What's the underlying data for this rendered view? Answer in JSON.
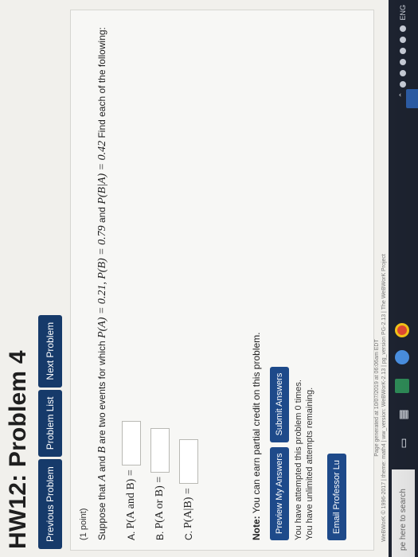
{
  "header": {
    "title": "HW12: Problem 4"
  },
  "nav": {
    "previous": "Previous Problem",
    "list": "Problem List",
    "next": "Next Problem"
  },
  "problem": {
    "points": "(1 point)",
    "intro": "Suppose that",
    "event_a": "A",
    "and": "and",
    "event_b": "B",
    "are_events": "are two events for which",
    "p_a": "P(A) = 0.21,",
    "p_b": "P(B) = 0.79",
    "and2": "and",
    "p_b_given_a": "P(B|A) = 0.42",
    "find": "Find each of the following:",
    "parts": [
      {
        "label": "A.",
        "expr": "P(A and B) ="
      },
      {
        "label": "B.",
        "expr": "P(A or B) ="
      },
      {
        "label": "C.",
        "expr": "P(A|B) ="
      }
    ]
  },
  "note": {
    "bold": "Note:",
    "text": "You can earn partial credit on this problem."
  },
  "actions": {
    "preview": "Preview My Answers",
    "submit": "Submit Answers"
  },
  "attempts": {
    "line1": "You have attempted this problem 0 times.",
    "line2": "You have unlimited attempts remaining."
  },
  "email": {
    "label": "Email Professor Lu"
  },
  "footer": {
    "line1": "Page generated at 10/07/2019 at 06:06am EDT",
    "line2": "WeBWorK © 1996-2017 | theme: math4 | ww_version: WeBWorK-2.13 | pg_version PG-2.13 | The WeBWorK Project"
  },
  "taskbar": {
    "search_placeholder": "pe here to search",
    "tray_text": "ENG"
  },
  "colors": {
    "nav_button": "#163a6a",
    "action_button": "#1e4a8a",
    "panel_bg": "#f7f7f5",
    "taskbar": "#1d2330"
  }
}
